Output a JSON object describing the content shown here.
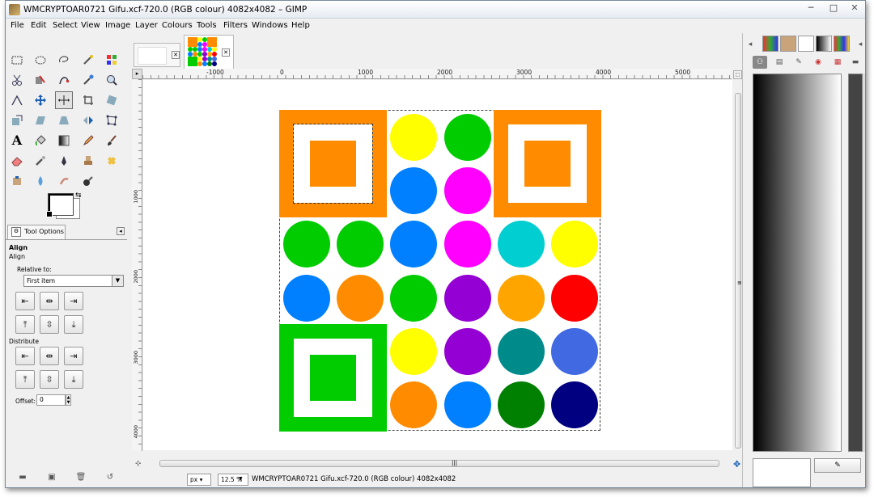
{
  "window": {
    "title": "WMCRYPTOAR0721 Gifu.xcf-720.0 (RGB colour) 4082x4082 – GIMP",
    "minimize": "─",
    "maximize": "□",
    "close": "✕"
  },
  "menu": [
    "File",
    "Edit",
    "Select",
    "View",
    "Image",
    "Layer",
    "Colours",
    "Tools",
    "Filters",
    "Windows",
    "Help"
  ],
  "tool_options": {
    "tab_label": "Tool Options",
    "heading": "Align",
    "subheading": "Align",
    "relative_to_label": "Relative to:",
    "relative_to_value": "First item",
    "distribute_label": "Distribute",
    "offset_label": "Offset:",
    "offset_value": "0"
  },
  "image_tabs": {
    "close": "✕"
  },
  "rulers": {
    "h": [
      "-1000",
      "0",
      "1000",
      "2000",
      "3000",
      "4000",
      "5000"
    ],
    "v": [
      "1000",
      "2000",
      "3000",
      "4000"
    ]
  },
  "status": {
    "unit": "px",
    "zoom": "12.5 %",
    "text": "WMCRYPTOAR0721 Gifu.xcf-720.0 (RGB colour) 4082x4082"
  },
  "image": {
    "squares": [
      {
        "outer": "#FF8C00",
        "inner": "#FF8C00",
        "selected": true
      },
      {
        "outer": "#FF8C00",
        "inner": "#FF8C00",
        "selected": false
      },
      {
        "outer": "#00CC00",
        "inner": "#00CC00",
        "selected": false
      }
    ],
    "dots": [
      [
        "",
        "",
        "#FFFF00",
        "#00CC00",
        "",
        ""
      ],
      [
        "",
        "",
        "#0080FF",
        "#FF00FF",
        "",
        ""
      ],
      [
        "#00CC00",
        "#00CC00",
        "#0080FF",
        "#FF00FF",
        "#00CED1",
        "#FFFF00"
      ],
      [
        "#0080FF",
        "#FF8C00",
        "#00CC00",
        "#9400D3",
        "#FFA500",
        "#FF0000"
      ],
      [
        "",
        "",
        "#FFFF00",
        "#9400D3",
        "#008B8B",
        "#4169E1"
      ],
      [
        "",
        "",
        "#FF8C00",
        "#0080FF",
        "#008000",
        "#000080"
      ]
    ]
  },
  "colors": {
    "accent": "#1a5fb4"
  }
}
